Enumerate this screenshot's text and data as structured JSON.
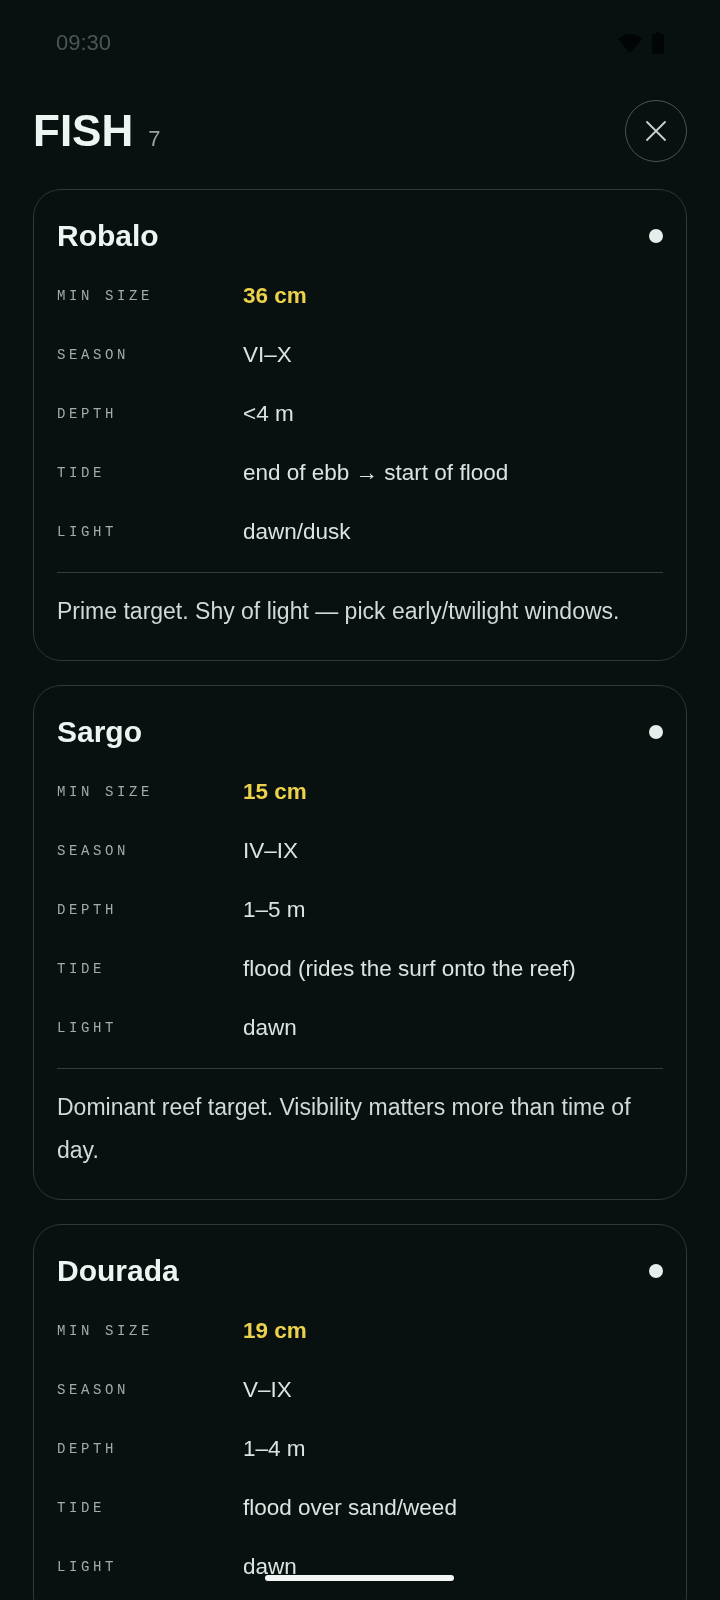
{
  "status_bar": {
    "time": "09:30"
  },
  "header": {
    "title": "FISH",
    "count": "7"
  },
  "fish": [
    {
      "name": "Robalo",
      "fields": [
        {
          "label": "MIN SIZE",
          "value": "36 cm",
          "kind": "size"
        },
        {
          "label": "SEASON",
          "value": "VI–X",
          "kind": "plain"
        },
        {
          "label": "DEPTH",
          "value": "<4 m",
          "kind": "plain"
        },
        {
          "label": "TIDE",
          "value": "end of ebb → start of flood",
          "kind": "plain"
        },
        {
          "label": "LIGHT",
          "value": "dawn/dusk",
          "kind": "plain"
        }
      ],
      "note": "Prime target. Shy of light — pick early/twilight windows."
    },
    {
      "name": "Sargo",
      "fields": [
        {
          "label": "MIN SIZE",
          "value": "15 cm",
          "kind": "size"
        },
        {
          "label": "SEASON",
          "value": "IV–IX",
          "kind": "plain"
        },
        {
          "label": "DEPTH",
          "value": "1–5 m",
          "kind": "plain"
        },
        {
          "label": "TIDE",
          "value": "flood (rides the surf onto the reef)",
          "kind": "plain"
        },
        {
          "label": "LIGHT",
          "value": "dawn",
          "kind": "plain"
        }
      ],
      "note": "Dominant reef target. Visibility matters more than time of day."
    },
    {
      "name": "Dourada",
      "fields": [
        {
          "label": "MIN SIZE",
          "value": "19 cm",
          "kind": "size"
        },
        {
          "label": "SEASON",
          "value": "V–IX",
          "kind": "plain"
        },
        {
          "label": "DEPTH",
          "value": "1–4 m",
          "kind": "plain"
        },
        {
          "label": "TIDE",
          "value": "flood over sand/weed",
          "kind": "plain"
        },
        {
          "label": "LIGHT",
          "value": "dawn",
          "kind": "plain"
        }
      ]
    }
  ]
}
